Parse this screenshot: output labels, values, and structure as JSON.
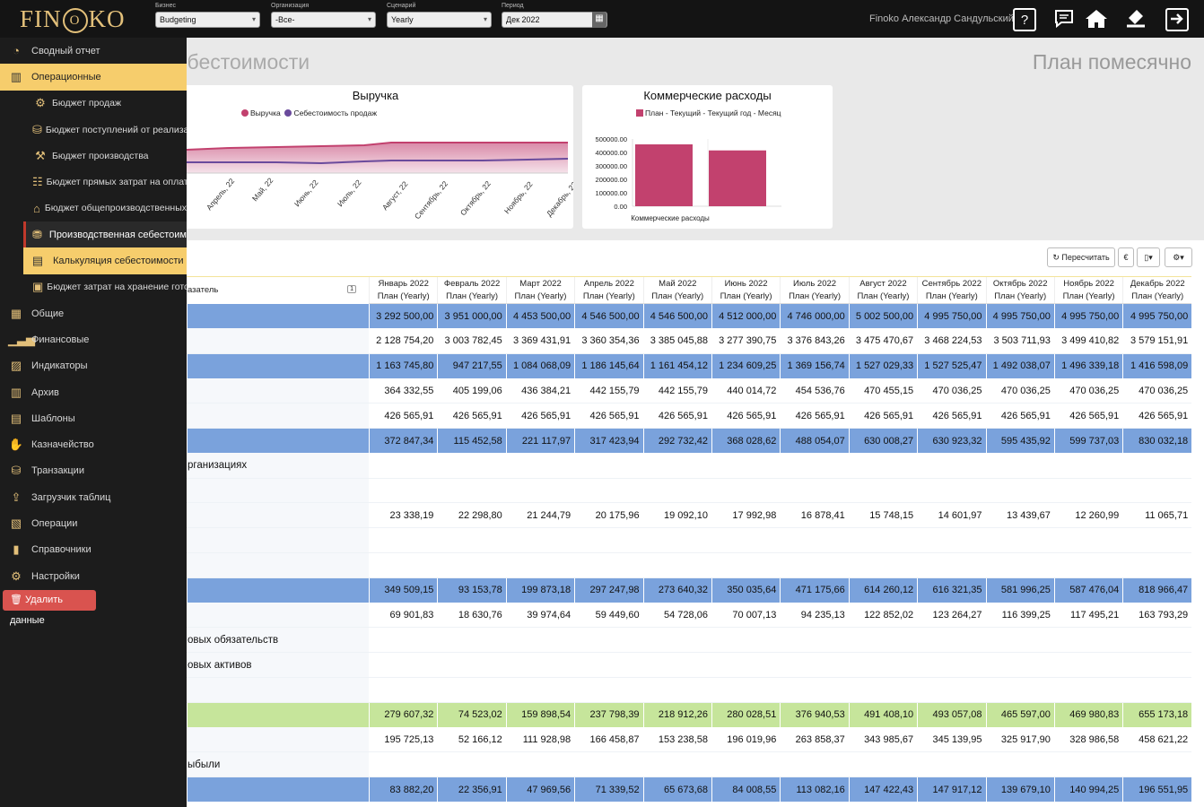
{
  "app": {
    "logo_text_1": "FIN",
    "logo_ring": "O",
    "logo_text_2": "KO",
    "user_name": "Finoko Александр Сандульский",
    "accent": "#f6cd6c"
  },
  "filters": {
    "business": {
      "label": "Бизнес",
      "value": "Budgeting"
    },
    "organization": {
      "label": "Организация",
      "value": "-Все-"
    },
    "scenario": {
      "label": "Сценарий",
      "value": "Yearly"
    },
    "period": {
      "label": "Период",
      "value": "Дек 2022"
    }
  },
  "sidebar": {
    "items": [
      {
        "label": "Сводный отчет",
        "icon": "dashboard-icon"
      },
      {
        "label": "Операционные",
        "icon": "factory-icon"
      },
      {
        "label": "Бюджет продаж",
        "icon": "sales-icon"
      },
      {
        "label": "Бюджет поступлений от реализации",
        "icon": "money-bag-icon"
      },
      {
        "label": "Бюджет производства",
        "icon": "production-icon"
      },
      {
        "label": "Бюджет прямых затрат на оплату",
        "icon": "workers-icon"
      },
      {
        "label": "Бюджет общепроизводственных",
        "icon": "overhead-icon"
      },
      {
        "label": "Производственная себестоимость",
        "icon": "cost-icon"
      },
      {
        "label": "Калькуляция себестоимости",
        "icon": "calculation-icon"
      },
      {
        "label": "Бюджет затрат на хранение готовой",
        "icon": "storage-icon"
      },
      {
        "label": "Общие",
        "icon": "general-icon"
      },
      {
        "label": "Финансовые",
        "icon": "finance-icon"
      },
      {
        "label": "Индикаторы",
        "icon": "indicators-icon"
      },
      {
        "label": "Архив",
        "icon": "archive-icon"
      },
      {
        "label": "Шаблоны",
        "icon": "templates-icon"
      },
      {
        "label": "Казначейство",
        "icon": "treasury-icon"
      },
      {
        "label": "Транзакции",
        "icon": "coins-icon"
      },
      {
        "label": "Загрузчик таблиц",
        "icon": "upload-icon"
      },
      {
        "label": "Операции",
        "icon": "operations-icon"
      },
      {
        "label": "Справочники",
        "icon": "book-icon"
      },
      {
        "label": "Настройки",
        "icon": "settings-icon"
      }
    ],
    "delete_button": "Удалить данные"
  },
  "page": {
    "title": "ебестоимости",
    "view": "План помесячно"
  },
  "revenue_chart": {
    "title": "Выручка",
    "legend": [
      "Выручка",
      "Себестоимость продаж"
    ],
    "colors": [
      "#c2416e",
      "#6a4a9c"
    ],
    "x_labels": [
      "Апрель, 22",
      "Май, 22",
      "Июнь, 22",
      "Июль, 22",
      "Август, 22",
      "Сентябрь, 22",
      "Октябрь, 22",
      "Ноябрь, 22",
      "Декабрь, 22"
    ]
  },
  "commercial_chart": {
    "title": "Коммерческие расходы",
    "legend": "План - Текущий - Текущий год - Месяц",
    "bar_color": "#c2416e",
    "y_ticks": [
      "500000.00",
      "400000.00",
      "300000.00",
      "200000.00",
      "100000.00",
      "0.00"
    ],
    "x_label": "Коммерческие расходы"
  },
  "chart_data": {
    "type": "bar",
    "title": "Коммерческие расходы",
    "categories": [
      "Коммерческие расходы"
    ],
    "series": [
      {
        "name": "План - Текущий - Текущий год - Месяц",
        "values": [
          460000,
          415000
        ]
      }
    ],
    "ylim": [
      0,
      500000
    ]
  },
  "toolbar": {
    "recalc": "Пересчитать",
    "currency": "€"
  },
  "table": {
    "first_header": "азатель",
    "first_header_badge": "1",
    "months": [
      "Январь 2022",
      "Февраль 2022",
      "Март 2022",
      "Апрель 2022",
      "Май 2022",
      "Июнь 2022",
      "Июль 2022",
      "Август 2022",
      "Сентябрь 2022",
      "Октябрь 2022",
      "Ноябрь 2022",
      "Декабрь 2022"
    ],
    "sub": "План (Yearly)",
    "rows": [
      {
        "style": "blue",
        "label": "",
        "values": [
          "3 292 500,00",
          "3 951 000,00",
          "4 453 500,00",
          "4 546 500,00",
          "4 546 500,00",
          "4 512 000,00",
          "4 746 000,00",
          "5 002 500,00",
          "4 995 750,00",
          "4 995 750,00",
          "4 995 750,00",
          "4 995 750,00"
        ]
      },
      {
        "style": "white",
        "label": "",
        "values": [
          "2 128 754,20",
          "3 003 782,45",
          "3 369 431,91",
          "3 360 354,36",
          "3 385 045,88",
          "3 277 390,75",
          "3 376 843,26",
          "3 475 470,67",
          "3 468 224,53",
          "3 503 711,93",
          "3 499 410,82",
          "3 579 151,91"
        ]
      },
      {
        "style": "blue",
        "label": "",
        "values": [
          "1 163 745,80",
          "947 217,55",
          "1 084 068,09",
          "1 186 145,64",
          "1 161 454,12",
          "1 234 609,25",
          "1 369 156,74",
          "1 527 029,33",
          "1 527 525,47",
          "1 492 038,07",
          "1 496 339,18",
          "1 416 598,09"
        ]
      },
      {
        "style": "white",
        "label": "",
        "values": [
          "364 332,55",
          "405 199,06",
          "436 384,21",
          "442 155,79",
          "442 155,79",
          "440 014,72",
          "454 536,76",
          "470 455,15",
          "470 036,25",
          "470 036,25",
          "470 036,25",
          "470 036,25"
        ]
      },
      {
        "style": "white",
        "label": "",
        "values": [
          "426 565,91",
          "426 565,91",
          "426 565,91",
          "426 565,91",
          "426 565,91",
          "426 565,91",
          "426 565,91",
          "426 565,91",
          "426 565,91",
          "426 565,91",
          "426 565,91",
          "426 565,91"
        ]
      },
      {
        "style": "blue",
        "label": "",
        "values": [
          "372 847,34",
          "115 452,58",
          "221 117,97",
          "317 423,94",
          "292 732,42",
          "368 028,62",
          "488 054,07",
          "630 008,27",
          "630 923,32",
          "595 435,92",
          "599 737,03",
          "830 032,18"
        ]
      },
      {
        "style": "empty",
        "label": "рганизациях",
        "values": []
      },
      {
        "style": "empty",
        "label": "",
        "values": []
      },
      {
        "style": "white",
        "label": "",
        "values": [
          "23 338,19",
          "22 298,80",
          "21 244,79",
          "20 175,96",
          "19 092,10",
          "17 992,98",
          "16 878,41",
          "15 748,15",
          "14 601,97",
          "13 439,67",
          "12 260,99",
          "11 065,71"
        ]
      },
      {
        "style": "empty",
        "label": "",
        "values": []
      },
      {
        "style": "empty",
        "label": "",
        "values": []
      },
      {
        "style": "blue",
        "label": "",
        "values": [
          "349 509,15",
          "93 153,78",
          "199 873,18",
          "297 247,98",
          "273 640,32",
          "350 035,64",
          "471 175,66",
          "614 260,12",
          "616 321,35",
          "581 996,25",
          "587 476,04",
          "818 966,47"
        ]
      },
      {
        "style": "white",
        "label": "",
        "values": [
          "69 901,83",
          "18 630,76",
          "39 974,64",
          "59 449,60",
          "54 728,06",
          "70 007,13",
          "94 235,13",
          "122 852,02",
          "123 264,27",
          "116 399,25",
          "117 495,21",
          "163 793,29"
        ]
      },
      {
        "style": "empty",
        "label": "овых обязательств",
        "values": []
      },
      {
        "style": "empty",
        "label": "овых активов",
        "values": []
      },
      {
        "style": "empty",
        "label": "",
        "values": []
      },
      {
        "style": "green",
        "label": "",
        "values": [
          "279 607,32",
          "74 523,02",
          "159 898,54",
          "237 798,39",
          "218 912,26",
          "280 028,51",
          "376 940,53",
          "491 408,10",
          "493 057,08",
          "465 597,00",
          "469 980,83",
          "655 173,18"
        ]
      },
      {
        "style": "white",
        "label": "",
        "values": [
          "195 725,13",
          "52 166,12",
          "111 928,98",
          "166 458,87",
          "153 238,58",
          "196 019,96",
          "263 858,37",
          "343 985,67",
          "345 139,95",
          "325 917,90",
          "328 986,58",
          "458 621,22"
        ]
      },
      {
        "style": "empty",
        "label": "ыбыли",
        "values": []
      },
      {
        "style": "blue",
        "label": "",
        "values": [
          "83 882,20",
          "22 356,91",
          "47 969,56",
          "71 339,52",
          "65 673,68",
          "84 008,55",
          "113 082,16",
          "147 422,43",
          "147 917,12",
          "139 679,10",
          "140 994,25",
          "196 551,95"
        ]
      }
    ]
  }
}
